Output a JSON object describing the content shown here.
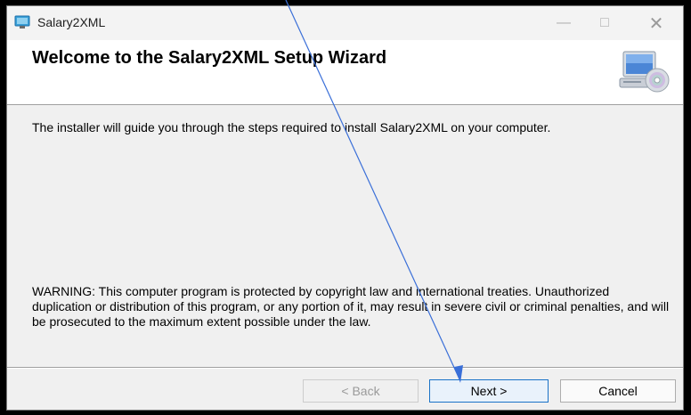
{
  "window": {
    "title": "Salary2XML",
    "controls": {
      "minimize_icon": "minimize-icon",
      "maximize_icon": "maximize-icon",
      "close_icon": "close-icon"
    }
  },
  "header": {
    "title": "Welcome to the Salary2XML Setup Wizard",
    "icon": "computer-cd-icon"
  },
  "body": {
    "intro": "The installer will guide you through the steps required to install Salary2XML on your computer.",
    "warning": "WARNING: This computer program is protected by copyright law and international treaties. Unauthorized duplication or distribution of this program, or any portion of it, may result in severe civil or criminal penalties, and will be prosecuted to the maximum extent possible under the law."
  },
  "buttons": {
    "back": "< Back",
    "next": "Next >",
    "cancel": "Cancel"
  },
  "colors": {
    "arrow": "#3a6fd8",
    "next_border": "#1a73c7"
  }
}
